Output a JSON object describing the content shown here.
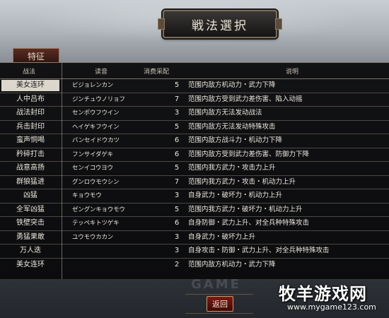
{
  "title": "戦法選択",
  "tab": {
    "label": "特征"
  },
  "columns": {
    "name": "战法",
    "reading": "读音",
    "cost": "消费采配",
    "desc": "说明"
  },
  "rows": [
    {
      "name": "美女连环",
      "reading": "ビジョレンカン",
      "cost": "5",
      "desc": "范围内敌方机动力・武力下降",
      "selected": true
    },
    {
      "name": "人中吕布",
      "reading": "ジンチュウノリョフ",
      "cost": "7",
      "desc": "范围内敌方受到武力差伤害、陷入动摇"
    },
    {
      "name": "战法封印",
      "reading": "センポウフウイン",
      "cost": "3",
      "desc": "范围内敌方无法发动战法"
    },
    {
      "name": "兵击封印",
      "reading": "ヘイゲキフウイン",
      "cost": "5",
      "desc": "范围内敌方无法发动特殊攻击"
    },
    {
      "name": "蛮声恫喝",
      "reading": "バンセイドウカツ",
      "cost": "6",
      "desc": "范围内敌方战斗力・机动力下降"
    },
    {
      "name": "矜碎打击",
      "reading": "フンサイダゲキ",
      "cost": "6",
      "desc": "范围内敌方受到武力差伤害、防御力下降"
    },
    {
      "name": "战意高扬",
      "reading": "センイコウヨウ",
      "cost": "5",
      "desc": "范围内我方武力・攻击力上升"
    },
    {
      "name": "群狼猛进",
      "reading": "グンロウモウシン",
      "cost": "7",
      "desc": "范围内我方武力・攻击・机动力上升"
    },
    {
      "name": "凶猛",
      "reading": "キョウモウ",
      "cost": "3",
      "desc": "自身武力・破坏力・机动力上升"
    },
    {
      "name": "全军凶猛",
      "reading": "ゼングンキョウモウ",
      "cost": "5",
      "desc": "范围内我方武力・破坏力・机动力上升"
    },
    {
      "name": "铁壁突击",
      "reading": "テッペキトツゲキ",
      "cost": "6",
      "desc": "自身防御・武力上升、对全兵种特殊攻击"
    },
    {
      "name": "勇猛果敢",
      "reading": "ユウモウカカン",
      "cost": "3",
      "desc": "自身武力・破坏力上升"
    },
    {
      "name": "万人迭",
      "reading": "",
      "cost": "3",
      "desc": "自身攻击・防御・武力上升、对全兵种特殊攻击"
    },
    {
      "name": "美女连环",
      "reading": "",
      "cost": "2",
      "desc": "范围内敌方机动力・武力下降"
    }
  ],
  "back_button": {
    "label": "返回"
  },
  "watermark": {
    "faint": "GAME",
    "site_name": "牧羊游戏网",
    "site_url": "www.mygame123.com"
  }
}
